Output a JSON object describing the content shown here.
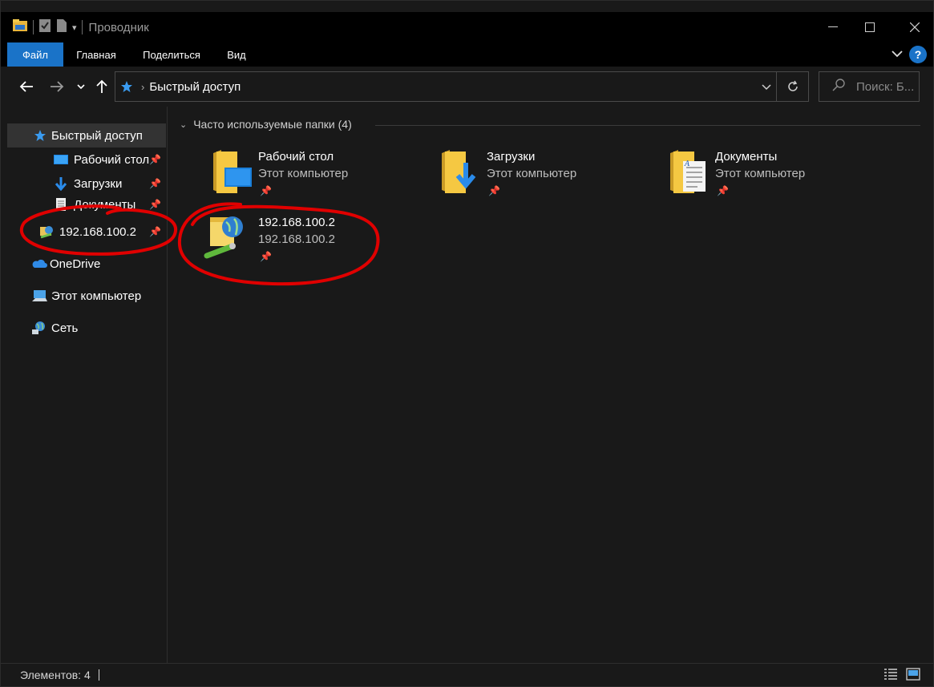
{
  "window": {
    "title": "Проводник"
  },
  "ribbon": {
    "tabs": [
      {
        "label": "Файл"
      },
      {
        "label": "Главная"
      },
      {
        "label": "Поделиться"
      },
      {
        "label": "Вид"
      }
    ],
    "help_label": "?"
  },
  "address": {
    "crumb": "Быстрый доступ"
  },
  "search": {
    "placeholder": "Поиск: Б..."
  },
  "sidebar": {
    "items": [
      {
        "label": "Быстрый доступ",
        "icon": "star-icon",
        "selected": true
      },
      {
        "label": "Рабочий стол",
        "icon": "desktop-icon",
        "pinned": true
      },
      {
        "label": "Загрузки",
        "icon": "download-arrow-icon",
        "pinned": true
      },
      {
        "label": "Документы",
        "icon": "documents-icon",
        "pinned": true
      },
      {
        "label": "192.168.100.2",
        "icon": "network-folder-icon",
        "pinned": true
      },
      {
        "label": "OneDrive",
        "icon": "onedrive-cloud-icon"
      },
      {
        "label": "Этот компьютер",
        "icon": "computer-icon"
      },
      {
        "label": "Сеть",
        "icon": "network-icon"
      }
    ]
  },
  "content": {
    "group_label": "Часто используемые папки (4)",
    "tiles": [
      {
        "name": "Рабочий стол",
        "location": "Этот компьютер",
        "icon": "desktop-folder-icon"
      },
      {
        "name": "Загрузки",
        "location": "Этот компьютер",
        "icon": "downloads-folder-icon"
      },
      {
        "name": "Документы",
        "location": "Этот компьютер",
        "icon": "documents-folder-icon"
      },
      {
        "name": "192.168.100.2",
        "location": "192.168.100.2",
        "icon": "network-share-icon"
      }
    ]
  },
  "status": {
    "items_text": "Элементов: 4"
  },
  "colors": {
    "accent": "#1a73c8",
    "background": "#191919",
    "annotation": "#e00000"
  }
}
